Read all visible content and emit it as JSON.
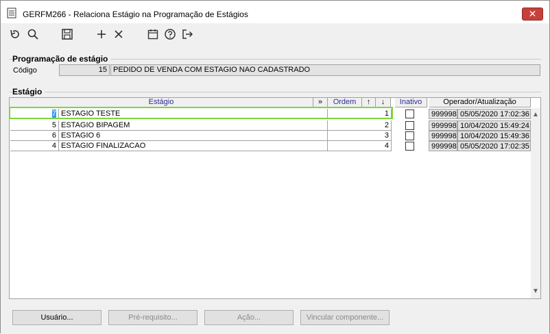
{
  "window": {
    "title": "GERFM266 - Relaciona Estágio na Programação de Estágios",
    "close_label": "✕"
  },
  "toolbar": {
    "icons": [
      "undo-icon",
      "search-icon",
      "save-icon",
      "add-icon",
      "delete-icon",
      "calendar-icon",
      "help-icon",
      "exit-icon"
    ]
  },
  "programacao": {
    "group_title": "Programação de estágio",
    "codigo_label": "Código",
    "codigo_value": "15",
    "descricao_value": "PEDIDO DE VENDA COM ESTAGIO NAO CADASTRADO"
  },
  "estagio": {
    "group_title": "Estágio",
    "headers": {
      "estagio": "Estágio",
      "expand": "»",
      "ordem": "Ordem",
      "up": "↑",
      "down": "↓",
      "inativo": "Inativo",
      "operador": "Operador/Atualização"
    },
    "rows": [
      {
        "codigo": "7",
        "nome": "ESTAGIO TESTE",
        "ordem": "1",
        "inativo": false,
        "operador": "999998",
        "atualizacao": "05/05/2020 17:02:36"
      },
      {
        "codigo": "5",
        "nome": "ESTAGIO BIPAGEM",
        "ordem": "2",
        "inativo": false,
        "operador": "999998",
        "atualizacao": "10/04/2020 15:49:24"
      },
      {
        "codigo": "6",
        "nome": "ESTAGIO 6",
        "ordem": "3",
        "inativo": false,
        "operador": "999998",
        "atualizacao": "10/04/2020 15:49:36"
      },
      {
        "codigo": "4",
        "nome": "ESTAGIO FINALIZACAO",
        "ordem": "4",
        "inativo": false,
        "operador": "999998",
        "atualizacao": "05/05/2020 17:02:35"
      }
    ]
  },
  "buttons": {
    "usuario": "Usuário...",
    "prerequisito": "Pré-requisito...",
    "acao": "Ação...",
    "vincular": "Vincular componente..."
  },
  "colors": {
    "selection_outline": "#7bd63a",
    "selected_cell": "#3399ff",
    "close_button": "#c7403a"
  }
}
